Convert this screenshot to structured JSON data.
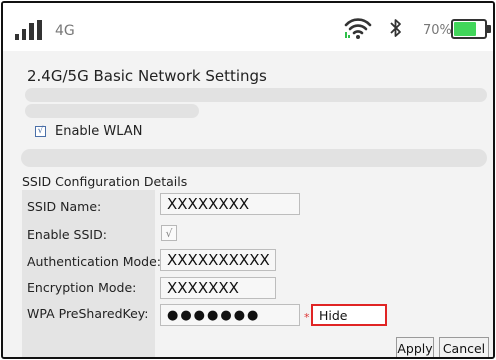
{
  "status": {
    "network": "4G",
    "battery_percent": "70%",
    "battery_level": 0.7
  },
  "page": {
    "title": "2.4G/5G Basic Network Settings",
    "enable_wlan_label": "Enable WLAN",
    "enable_wlan_check": "√"
  },
  "ssid": {
    "section_title": "SSID Configuration Details",
    "labels": {
      "name": "SSID Name:",
      "enable": "Enable SSID:",
      "auth": "Authentication Mode:",
      "encryption": "Encryption Mode:",
      "psk": "WPA PreSharedKey:"
    },
    "values": {
      "name": "XXXXXXXX",
      "enable_check": "√",
      "auth": "XXXXXXXXXX",
      "encryption": "XXXXXXX",
      "psk": "●●●●●●●"
    },
    "required_mark": "*",
    "hide_label": "Hide"
  },
  "actions": {
    "apply": "Apply",
    "cancel": "Cancel"
  },
  "colors": {
    "battery_fill": "#41d65a",
    "wifi_accent": "#2fbf4a",
    "highlight": "#e02424"
  }
}
